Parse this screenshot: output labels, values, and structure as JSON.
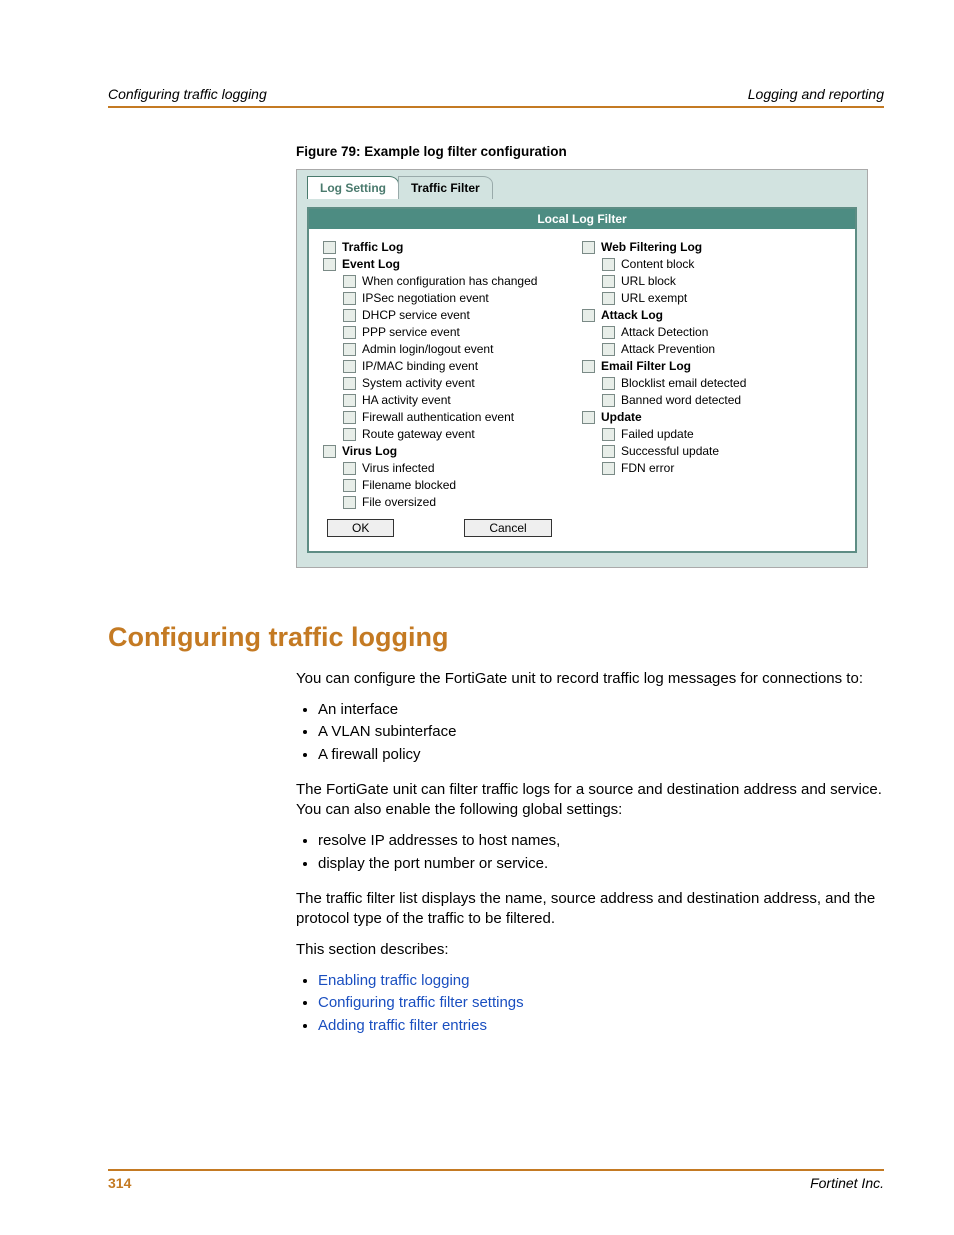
{
  "header": {
    "left": "Configuring traffic logging",
    "right": "Logging and reporting"
  },
  "figure": {
    "caption": "Figure 79: Example log filter configuration",
    "tabs": {
      "t1": "Log Setting",
      "t2": "Traffic Filter"
    },
    "panel_title": "Local Log Filter",
    "buttons": {
      "ok": "OK",
      "cancel": "Cancel"
    },
    "left_col": {
      "traffic": "Traffic Log",
      "event": "Event Log",
      "e1": "When configuration has changed",
      "e2": "IPSec negotiation event",
      "e3": "DHCP service event",
      "e4": "PPP service event",
      "e5": "Admin login/logout event",
      "e6": "IP/MAC binding event",
      "e7": "System activity event",
      "e8": "HA activity event",
      "e9": "Firewall authentication event",
      "e10": "Route gateway event",
      "virus": "Virus Log",
      "v1": "Virus infected",
      "v2": "Filename blocked",
      "v3": "File oversized"
    },
    "right_col": {
      "web": "Web Filtering Log",
      "w1": "Content block",
      "w2": "URL block",
      "w3": "URL exempt",
      "attack": "Attack Log",
      "a1": "Attack Detection",
      "a2": "Attack Prevention",
      "email": "Email Filter Log",
      "m1": "Blocklist email detected",
      "m2": "Banned word detected",
      "update": "Update",
      "u1": "Failed update",
      "u2": "Successful update",
      "u3": "FDN error"
    }
  },
  "section": {
    "title": "Configuring traffic logging",
    "p1": "You can configure the FortiGate unit to record traffic log messages for connections to:",
    "list1": [
      "An interface",
      "A VLAN subinterface",
      "A firewall policy"
    ],
    "p2": "The FortiGate unit can filter traffic logs for a source and destination address and service. You can also enable the following global settings:",
    "list2": [
      "resolve IP addresses to host names,",
      "display the port number or service."
    ],
    "p3": "The traffic filter list displays the name, source address and destination address, and the protocol type of the traffic to be filtered.",
    "p4": "This section describes:",
    "list3": [
      "Enabling traffic logging",
      "Configuring traffic filter settings",
      "Adding traffic filter entries"
    ]
  },
  "footer": {
    "page": "314",
    "company": "Fortinet Inc."
  }
}
